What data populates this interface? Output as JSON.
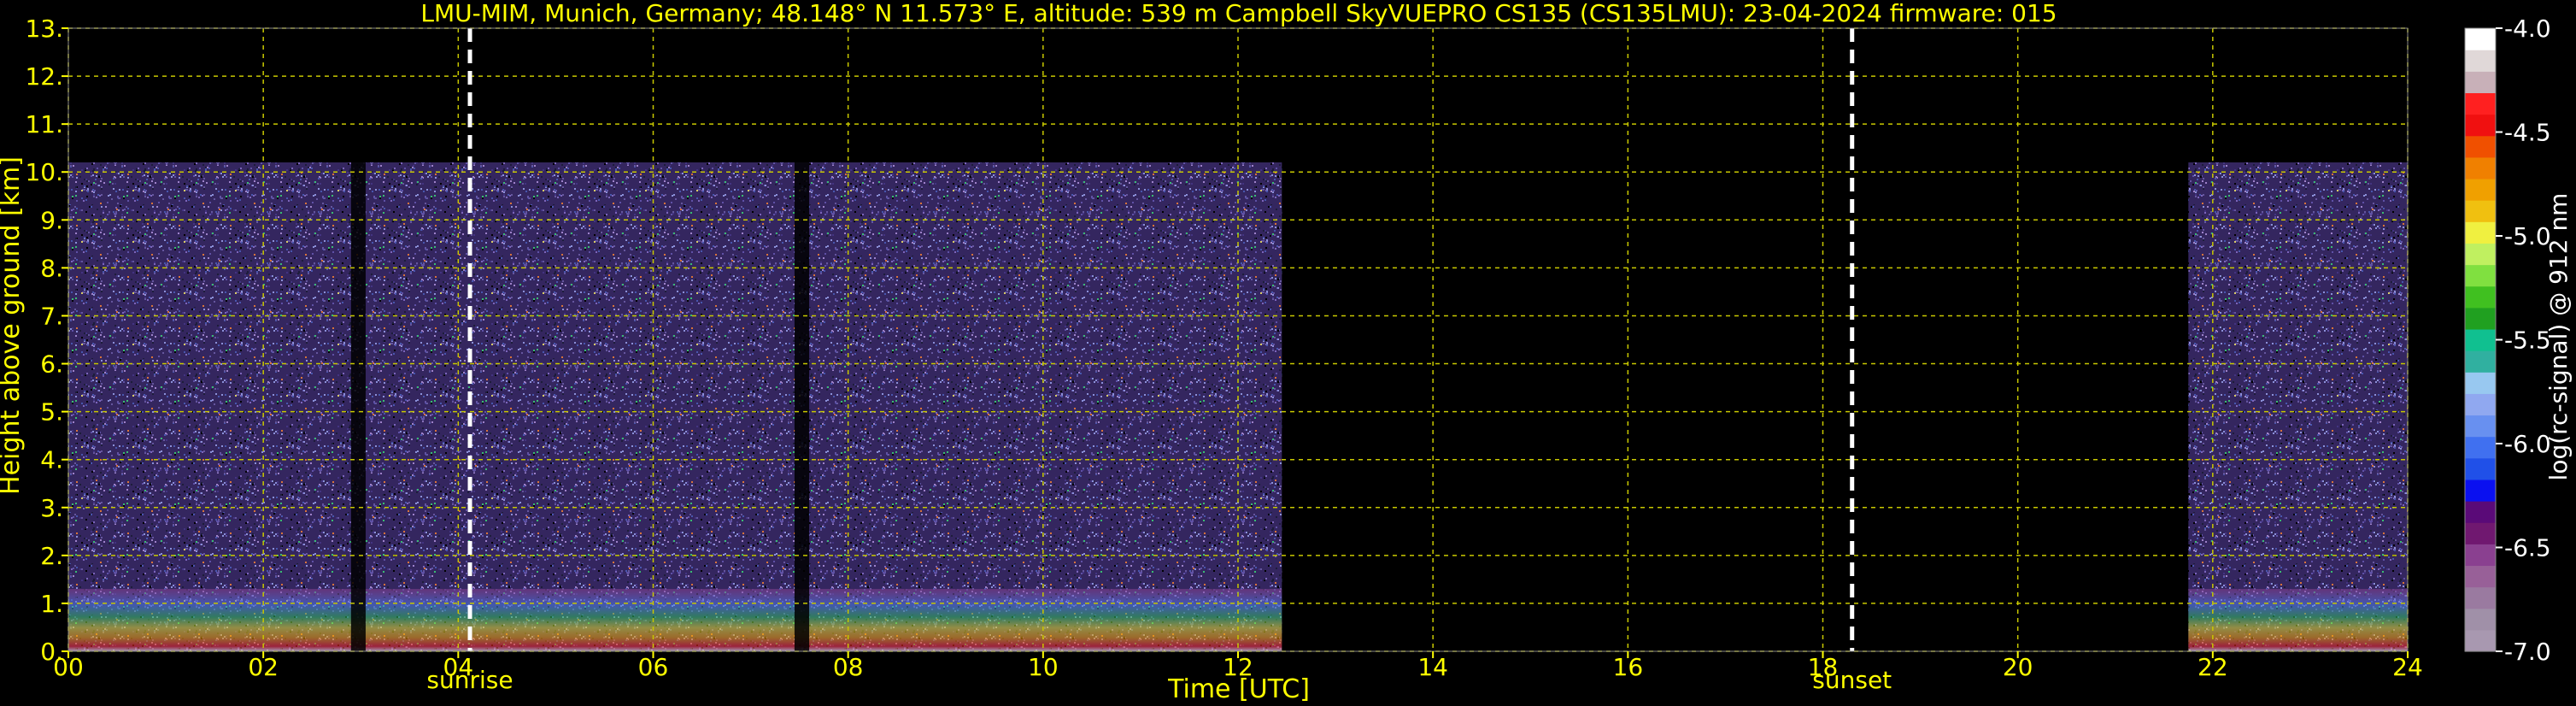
{
  "chart_data": {
    "type": "heatmap",
    "title": "LMU-MIM, Munich, Germany; 48.148° N 11.573° E, altitude: 539 m    Campbell SkyVUEPRO CS135 (CS135LMU): 23-04-2024    firmware: 015",
    "xlabel": "Time [UTC]",
    "ylabel": "Height above ground [km]",
    "xlim": [
      0,
      24
    ],
    "ylim": [
      0,
      13
    ],
    "x_ticks": [
      "00",
      "02",
      "04",
      "06",
      "08",
      "10",
      "12",
      "14",
      "16",
      "18",
      "20",
      "22",
      "24"
    ],
    "y_ticks": [
      "0.",
      "1.",
      "2.",
      "3.",
      "4.",
      "5.",
      "6.",
      "7.",
      "8.",
      "9.",
      "10.",
      "11.",
      "12.",
      "13."
    ],
    "grid": true,
    "markers": [
      {
        "label": "sunrise",
        "x": 4.12
      },
      {
        "label": "sunset",
        "x": 18.3
      }
    ],
    "data_segments": [
      {
        "x_start": 0.0,
        "x_end": 12.45,
        "top_km": 10.2
      },
      {
        "x_start": 21.75,
        "x_end": 24.0,
        "top_km": 10.2
      }
    ],
    "colorbar": {
      "label": "log(rc-signal) @ 912 nm",
      "ticks": [
        "-4.0",
        "-4.5",
        "-5.0",
        "-5.5",
        "-6.0",
        "-6.5",
        "-7.0"
      ],
      "range": [
        -7.0,
        -4.0
      ],
      "colors": [
        "#a898b0",
        "#a090a8",
        "#9a7aa0",
        "#986098",
        "#8a4090",
        "#701870",
        "#5a0a78",
        "#0a10f0",
        "#2050e8",
        "#4070f0",
        "#6890f0",
        "#90a8f0",
        "#98c8f0",
        "#30b0a0",
        "#10c090",
        "#20a020",
        "#40c020",
        "#80e040",
        "#c0f060",
        "#f0f040",
        "#f0c010",
        "#f0a000",
        "#f08000",
        "#f05000",
        "#f01010",
        "#ff2020",
        "#c8b0b8",
        "#e0d8d8",
        "#ffffff"
      ]
    }
  }
}
